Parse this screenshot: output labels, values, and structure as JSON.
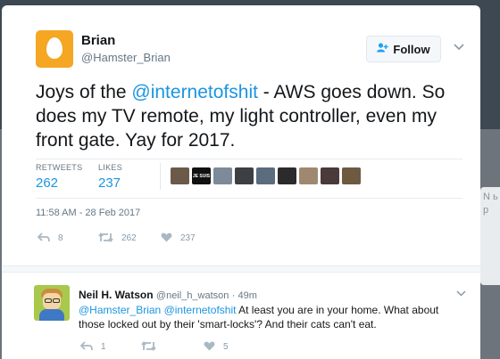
{
  "tweet": {
    "author_name": "Brian",
    "author_handle": "@Hamster_Brian",
    "follow_label": "Follow",
    "text_before": "Joys of the ",
    "mention": "@internetofshit",
    "text_after": " - AWS goes down. So does my TV remote, my light controller, even my front gate. Yay for 2017.",
    "retweets_label": "RETWEETS",
    "retweets_count": "262",
    "likes_label": "LIKES",
    "likes_count": "237",
    "timestamp": "11:58 AM - 28 Feb 2017",
    "actions": {
      "reply_count": "8",
      "retweet_count": "262",
      "like_count": "237"
    },
    "liker_avatar_colors": [
      "#6b5a4a",
      "#111111",
      "#7d8a99",
      "#3c3f44",
      "#5a6c7e",
      "#2b2b2b",
      "#a08870",
      "#4a3a3a",
      "#6e5a40"
    ],
    "face_text": "JE SUIS"
  },
  "reply": {
    "author_name": "Neil H. Watson",
    "author_handle": "@neil_h_watson",
    "time": "· 49m",
    "mention1": "@Hamster_Brian",
    "mention2": "@internetofshit",
    "text": " At least you are in your home. What about those locked out by their 'smart-locks'? And their cats can't eat.",
    "actions": {
      "reply_count": "1",
      "like_count": "5"
    }
  },
  "background": {
    "side_text": "N ь р"
  },
  "colors": {
    "accent": "#1b95e0",
    "egg": "#f5a623"
  }
}
